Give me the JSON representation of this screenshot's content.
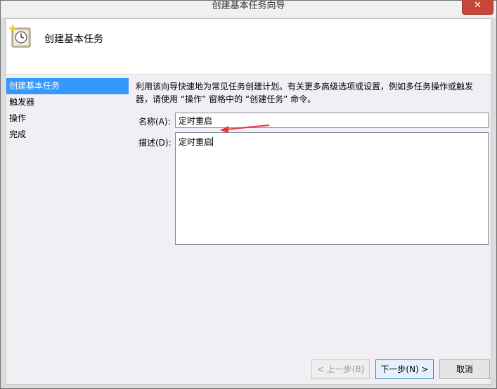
{
  "window": {
    "title": "创建基本任务向导",
    "close_glyph": "✕"
  },
  "header": {
    "title": "创建基本任务",
    "icon": "clock-task-icon"
  },
  "steps": [
    {
      "label": "创建基本任务",
      "active": true
    },
    {
      "label": "触发器",
      "active": false
    },
    {
      "label": "操作",
      "active": false
    },
    {
      "label": "完成",
      "active": false
    }
  ],
  "content": {
    "intro_line1": "利用该向导快速地为常见任务创建计划。有关更多高级选项或设置，例如多任务操作或触发",
    "intro_line2": "器，请使用 “操作” 窗格中的 “创建任务” 命令。",
    "name_label": "名称(A):",
    "name_value": "定时重启",
    "desc_label": "描述(D):",
    "desc_value": "定时重启"
  },
  "buttons": {
    "back": "< 上一步(B)",
    "next": "下一步(N) >",
    "cancel": "取消"
  },
  "colors": {
    "selection": "#3399ff",
    "close": "#c7473b",
    "arrow": "#e8333a"
  }
}
